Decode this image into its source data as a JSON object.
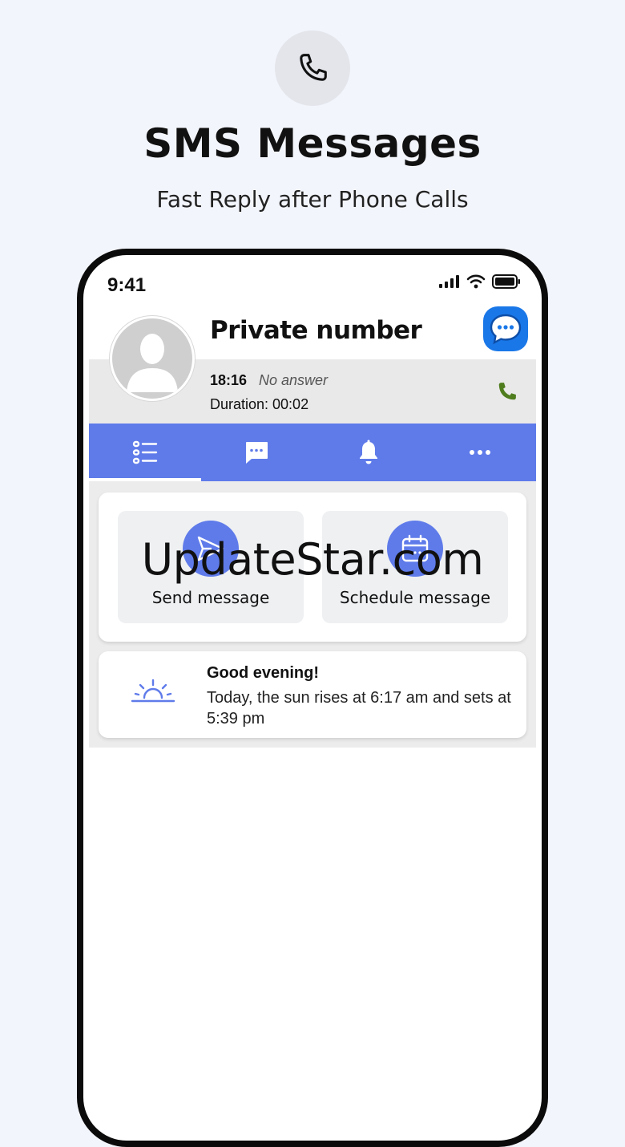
{
  "promo": {
    "icon": "phone-icon",
    "headline": "SMS Messages",
    "subline": "Fast Reply after Phone Calls"
  },
  "status_bar": {
    "time": "9:41",
    "icons": [
      "signal-icon",
      "wifi-icon",
      "battery-icon"
    ]
  },
  "caller": {
    "name": "Private number",
    "call_time": "18:16",
    "call_status": "No answer",
    "duration": "Duration: 00:02",
    "avatar_icon": "person-icon",
    "fab_icon": "chat-bubble-icon",
    "call_icon": "phone-icon"
  },
  "tabs": [
    {
      "icon": "list-icon",
      "selected": true
    },
    {
      "icon": "message-icon",
      "selected": false
    },
    {
      "icon": "bell-icon",
      "selected": false
    },
    {
      "icon": "more-icon",
      "selected": false
    }
  ],
  "actions": {
    "send_label": "Send message",
    "schedule_label": "Schedule message"
  },
  "greeting": {
    "title": "Good evening!",
    "text": "Today, the sun rises at 6:17 am and sets at 5:39 pm"
  },
  "watermark": "UpdateStar.com",
  "colors": {
    "accent": "#5f7bea",
    "fab": "#1977e8",
    "call_green": "#4f7d1e",
    "background": "#f3f5fc"
  }
}
